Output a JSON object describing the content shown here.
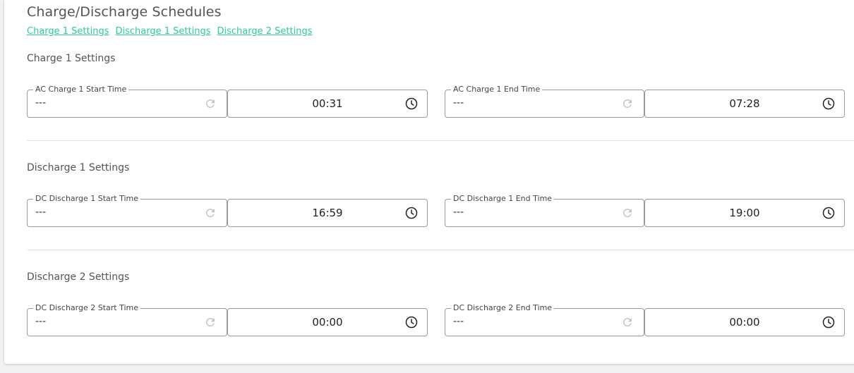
{
  "page": {
    "title": "Charge/Discharge Schedules"
  },
  "links": [
    {
      "label": "Charge 1 Settings"
    },
    {
      "label": "Discharge 1 Settings"
    },
    {
      "label": "Discharge 2 Settings"
    }
  ],
  "sections": [
    {
      "title": "Charge 1 Settings",
      "start": {
        "label": "AC Charge 1 Start Time",
        "current": "---",
        "time": "00:31"
      },
      "end": {
        "label": "AC Charge 1 End Time",
        "current": "---",
        "time": "07:28"
      }
    },
    {
      "title": "Discharge 1 Settings",
      "start": {
        "label": "DC Discharge 1 Start Time",
        "current": "---",
        "time": "16:59"
      },
      "end": {
        "label": "DC Discharge 1 End Time",
        "current": "---",
        "time": "19:00"
      }
    },
    {
      "title": "Discharge 2 Settings",
      "start": {
        "label": "DC Discharge 2 Start Time",
        "current": "---",
        "time": "00:00"
      },
      "end": {
        "label": "DC Discharge 2 End Time",
        "current": "---",
        "time": "00:00"
      }
    }
  ],
  "icons": {
    "refresh": "refresh-icon",
    "clock": "clock-icon"
  },
  "colors": {
    "link": "#2ecb8f",
    "border": "#9a9a9a",
    "refresh_icon": "#c4c4c4"
  }
}
